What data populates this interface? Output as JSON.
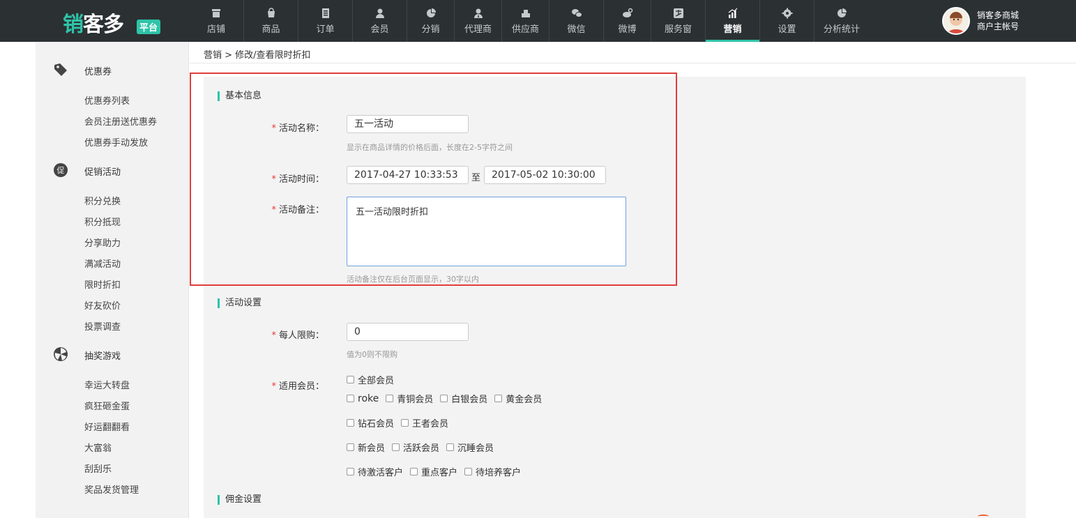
{
  "brand": {
    "name_main": "销",
    "name_rest": "客多",
    "badge": "平台"
  },
  "nav": [
    {
      "label": "店铺",
      "icon": "store-icon"
    },
    {
      "label": "商品",
      "icon": "bag-icon"
    },
    {
      "label": "订单",
      "icon": "order-icon"
    },
    {
      "label": "会员",
      "icon": "member-icon"
    },
    {
      "label": "分销",
      "icon": "pie-icon"
    },
    {
      "label": "代理商",
      "icon": "agent-icon"
    },
    {
      "label": "供应商",
      "icon": "supplier-icon"
    },
    {
      "label": "微信",
      "icon": "wechat-icon"
    },
    {
      "label": "微博",
      "icon": "weibo-icon"
    },
    {
      "label": "服务窗",
      "icon": "alipay-icon"
    },
    {
      "label": "营销",
      "icon": "chart-icon",
      "active": true
    },
    {
      "label": "设置",
      "icon": "gear-icon"
    },
    {
      "label": "分析统计",
      "icon": "pie-icon"
    }
  ],
  "user": {
    "line1": "销客多商城",
    "line2": "商户主帐号"
  },
  "sidebar": {
    "groups": [
      {
        "label": "优惠券",
        "icon": "tag-icon",
        "items": [
          "优惠券列表",
          "会员注册送优惠券",
          "优惠券手动发放"
        ]
      },
      {
        "label": "促销活动",
        "icon": "promo-icon",
        "items": [
          "积分兑换",
          "积分抵现",
          "分享助力",
          "满减活动",
          "限时折扣",
          "好友砍价",
          "投票调查"
        ]
      },
      {
        "label": "抽奖游戏",
        "icon": "wheel-icon",
        "items": [
          "幸运大转盘",
          "疯狂砸金蛋",
          "好运翻翻看",
          "大富翁",
          "刮刮乐",
          "奖品发货管理"
        ]
      }
    ]
  },
  "breadcrumb": "营销 > 修改/查看限时折扣",
  "basic": {
    "title": "基本信息",
    "name_label": "活动名称：",
    "name_value": "五一活动",
    "name_hint": "显示在商品详情的价格后面，长度在2-5字符之间",
    "time_label": "活动时间：",
    "time_start": "2017-04-27 10:33:53",
    "time_sep": "至",
    "time_end": "2017-05-02 10:30:00",
    "note_label": "活动备注：",
    "note_value": "五一活动限时折扣",
    "note_hint": "活动备注仅在后台页面显示，30字以内"
  },
  "settings": {
    "title": "活动设置",
    "limit_label": "每人限购：",
    "limit_value": "0",
    "limit_hint": "值为0则不限购",
    "members_label": "适用会员：",
    "rows": [
      [
        "全部会员"
      ],
      [
        "roke",
        "青铜会员",
        "白银会员",
        "黄金会员"
      ],
      [
        "钻石会员",
        "王者会员"
      ],
      [
        "新会员",
        "活跃会员",
        "沉睡会员"
      ],
      [
        "待激活客户",
        "重点客户",
        "待培养客户"
      ]
    ]
  },
  "commission": {
    "title": "佣金设置"
  },
  "required_mark": "*",
  "colors": {
    "accent": "#2ec4a8",
    "topbar": "#2b3133",
    "highlight_border": "#e23c3c"
  }
}
